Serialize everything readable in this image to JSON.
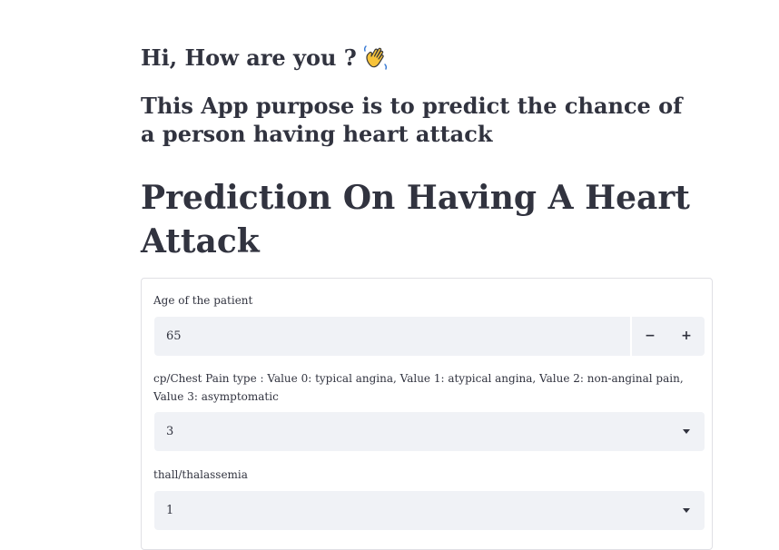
{
  "greeting": "Hi, How are you ?",
  "greeting_icon": "waving-hand-icon",
  "subtitle": "This App purpose is to predict the chance of a person having heart attack",
  "title": "Prediction On Having A Heart Attack",
  "form": {
    "age": {
      "label": "Age of the patient",
      "value": "65",
      "decrement": "−",
      "increment": "+"
    },
    "cp": {
      "label": "cp/Chest Pain type : Value 0: typical angina, Value 1: atypical angina, Value 2: non-anginal pain, Value 3: asymptomatic",
      "value": "3"
    },
    "thall": {
      "label": "thall/thalassemia",
      "value": "1"
    }
  }
}
